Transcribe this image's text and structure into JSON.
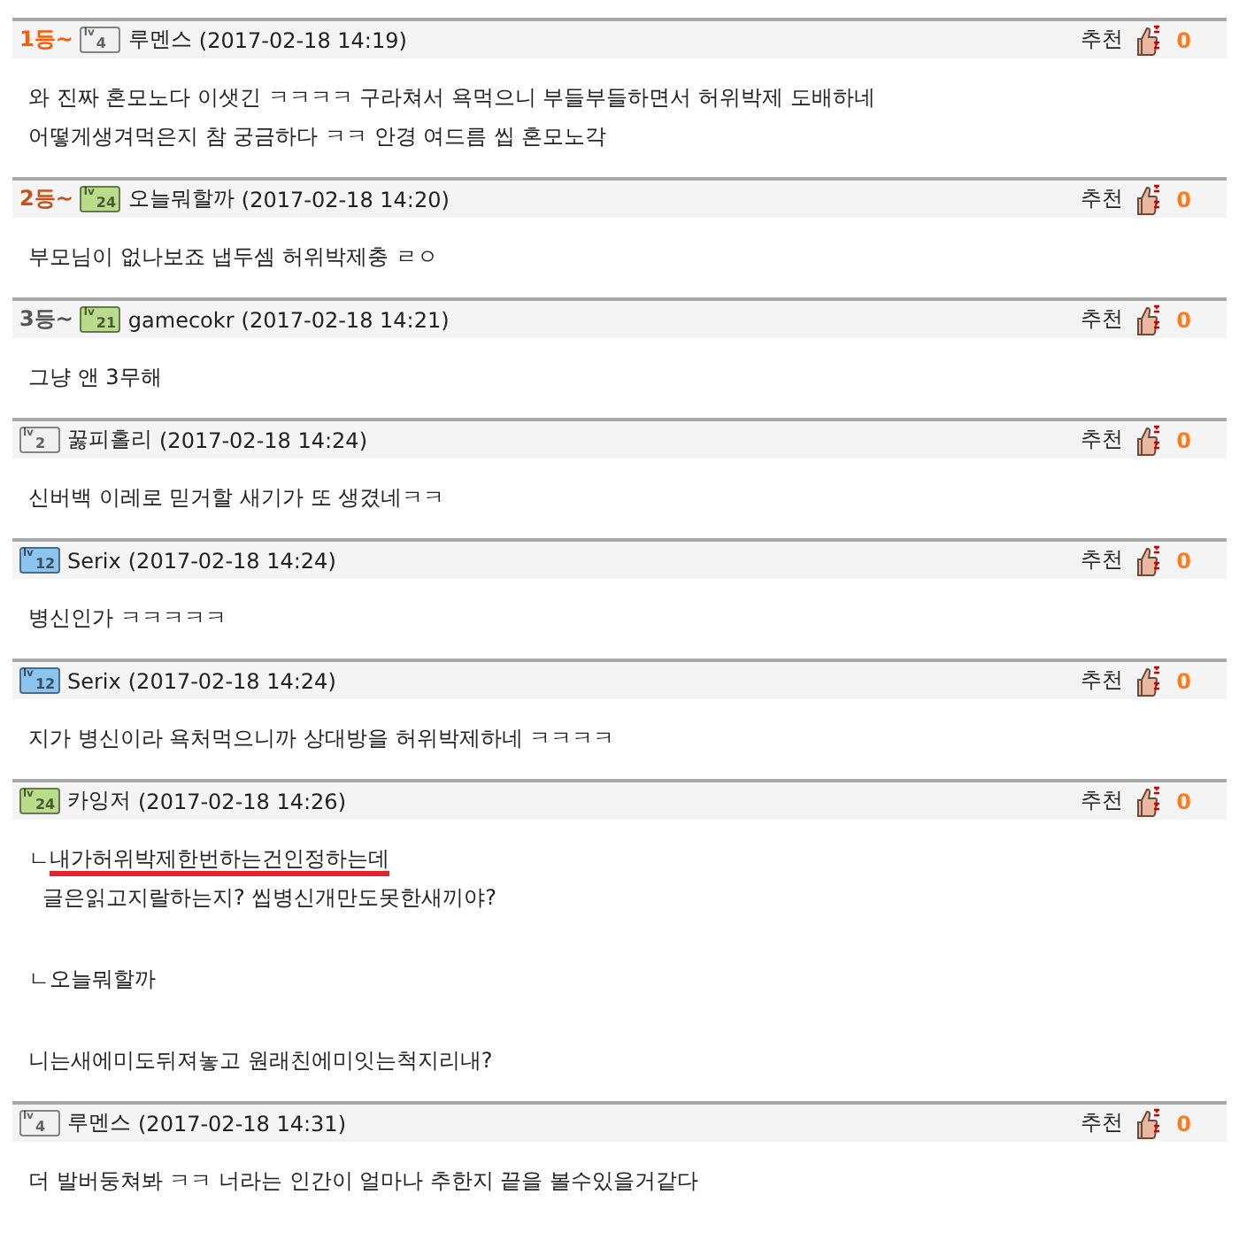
{
  "comments": [
    {
      "rank": {
        "text": "1등~",
        "kind": "gold"
      },
      "badge": {
        "prefix": "lv",
        "level": "4",
        "color": "#f0f0f0"
      },
      "author": "루멘스",
      "time": "(2017-02-18 14:19)",
      "recommend_label": "추천",
      "recommend_count": "0",
      "lines": [
        {
          "text": "와 진짜 혼모노다 이샛긴 ㅋㅋㅋㅋ 구라쳐서 욕먹으니 부들부들하면서 허위박제 도배하네"
        },
        {
          "text": "어떻게생겨먹은지 참 궁금하다 ㅋㅋ 안경 여드름 씹 혼모노각"
        }
      ]
    },
    {
      "rank": {
        "text": "2등~",
        "kind": "silver"
      },
      "badge": {
        "prefix": "lv",
        "level": "24",
        "color": "#b8dc8a"
      },
      "author": "오늘뭐할까",
      "time": "(2017-02-18 14:20)",
      "recommend_label": "추천",
      "recommend_count": "0",
      "lines": [
        {
          "text": "부모님이 없나보죠 냅두셈 허위박제충 ㄹㅇ"
        }
      ]
    },
    {
      "rank": {
        "text": "3등~",
        "kind": "bronze"
      },
      "badge": {
        "prefix": "lv",
        "level": "21",
        "color": "#b8dc8a"
      },
      "author": "gamecokr",
      "time": "(2017-02-18 14:21)",
      "recommend_label": "추천",
      "recommend_count": "0",
      "lines": [
        {
          "text": "그냥 앤 3무해"
        }
      ]
    },
    {
      "badge": {
        "prefix": "lv",
        "level": "2",
        "color": "#f0f0f0"
      },
      "author": "꿇피홀리",
      "time": "(2017-02-18 14:24)",
      "recommend_label": "추천",
      "recommend_count": "0",
      "lines": [
        {
          "text": "신버백 이레로 믿거할 새기가 또 생겼네ㅋㅋ"
        }
      ]
    },
    {
      "badge": {
        "prefix": "lv",
        "level": "12",
        "color": "#8cc4f0"
      },
      "author": "Serix",
      "time": "(2017-02-18 14:24)",
      "recommend_label": "추천",
      "recommend_count": "0",
      "lines": [
        {
          "text": "병신인가 ㅋㅋㅋㅋㅋ"
        }
      ]
    },
    {
      "badge": {
        "prefix": "lv",
        "level": "12",
        "color": "#8cc4f0"
      },
      "author": "Serix",
      "time": "(2017-02-18 14:24)",
      "recommend_label": "추천",
      "recommend_count": "0",
      "lines": [
        {
          "text": "지가 병신이라 욕처먹으니까 상대방을 허위박제하네 ㅋㅋㅋㅋ"
        }
      ]
    },
    {
      "badge": {
        "prefix": "lv",
        "level": "24",
        "color": "#b8dc8a"
      },
      "author": "카잉저",
      "time": "(2017-02-18 14:26)",
      "recommend_label": "추천",
      "recommend_count": "0",
      "lines": [
        {
          "prefix": "ㄴ",
          "text": "내가허위박제한번하는건인정하는데",
          "underlined": true
        },
        {
          "text": "글은읽고지랄하는지? 씹병신개만도못한새끼야?",
          "indented": true
        },
        {
          "text": "ㄴ오늘뭐할까",
          "gap_before": true
        },
        {
          "text": "니는새에미도뒤져놓고 원래친에미잇는척지리내?",
          "gap_before": true
        }
      ]
    },
    {
      "badge": {
        "prefix": "lv",
        "level": "4",
        "color": "#f0f0f0"
      },
      "author": "루멘스",
      "time": "(2017-02-18 14:31)",
      "recommend_label": "추천",
      "recommend_count": "0",
      "lines": [
        {
          "text": "더 발버둥쳐봐 ㅋㅋ 너라는 인간이 얼마나 추한지 끝을 볼수있을거같다"
        }
      ]
    }
  ]
}
